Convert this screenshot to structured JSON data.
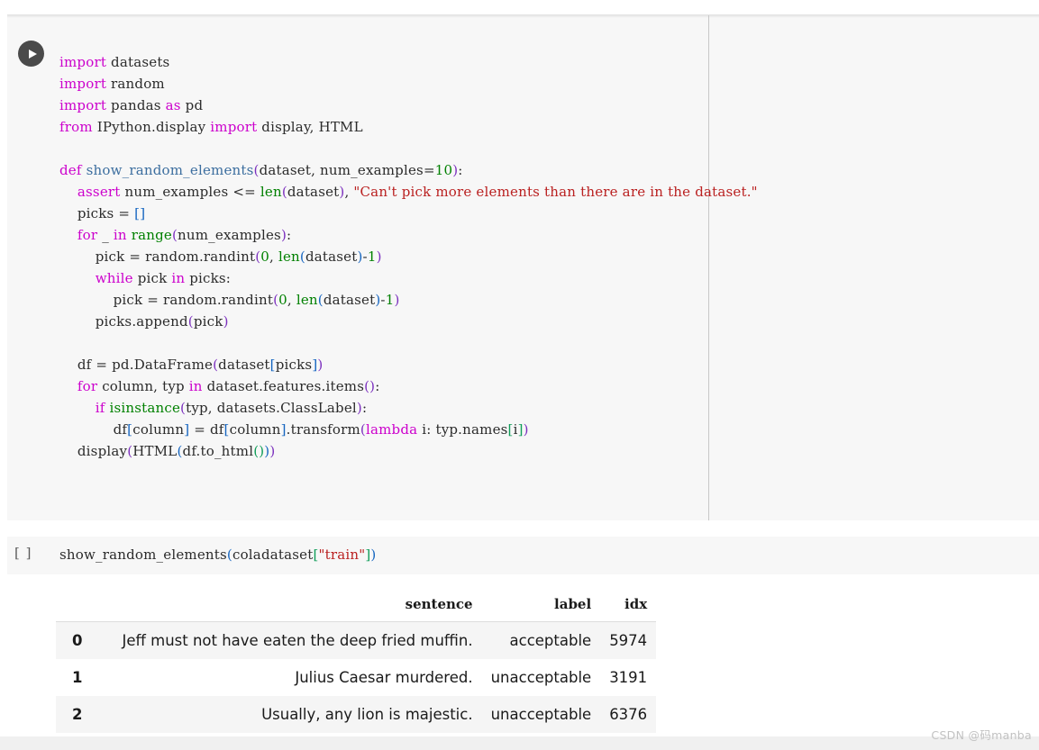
{
  "notebook": {
    "cells": [
      {
        "type": "code",
        "prompt": "",
        "run_icon": "play-icon",
        "source_lines": [
          "import datasets",
          "import random",
          "import pandas as pd",
          "from IPython.display import display, HTML",
          "",
          "def show_random_elements(dataset, num_examples=10):",
          "    assert num_examples <= len(dataset), \"Can't pick more elements than there are in the dataset.\"",
          "    picks = []",
          "    for _ in range(num_examples):",
          "        pick = random.randint(0, len(dataset)-1)",
          "        while pick in picks:",
          "            pick = random.randint(0, len(dataset)-1)",
          "        picks.append(pick)",
          "",
          "    df = pd.DataFrame(dataset[picks])",
          "    for column, typ in dataset.features.items():",
          "        if isinstance(typ, datasets.ClassLabel):",
          "            df[column] = df[column].transform(lambda i: typ.names[i])",
          "    display(HTML(df.to_html()))"
        ]
      },
      {
        "type": "code",
        "prompt": "[ ]",
        "source_lines": [
          "show_random_elements(coladataset[\"train\"])"
        ]
      }
    ]
  },
  "output_table": {
    "index_header": "",
    "columns": [
      "sentence",
      "label",
      "idx"
    ],
    "rows": [
      {
        "index": "0",
        "sentence": "Jeff must not have eaten the deep fried muffin.",
        "label": "acceptable",
        "idx": "5974"
      },
      {
        "index": "1",
        "sentence": "Julius Caesar murdered.",
        "label": "unacceptable",
        "idx": "3191"
      },
      {
        "index": "2",
        "sentence": "Usually, any lion is majestic.",
        "label": "unacceptable",
        "idx": "6376"
      }
    ]
  },
  "watermark": {
    "text": "CSDN @码manba"
  },
  "colors": {
    "cell_background": "#f7f7f7",
    "page_background": "#ffffff",
    "keyword": "#cc00cc",
    "builtin": "#008000",
    "string": "#ba2121",
    "number": "#008000",
    "function_name": "#3c6e9f",
    "run_button": "#4a4a4a",
    "row_stripe": "#f5f5f5",
    "watermark": "#c2c2c2"
  }
}
